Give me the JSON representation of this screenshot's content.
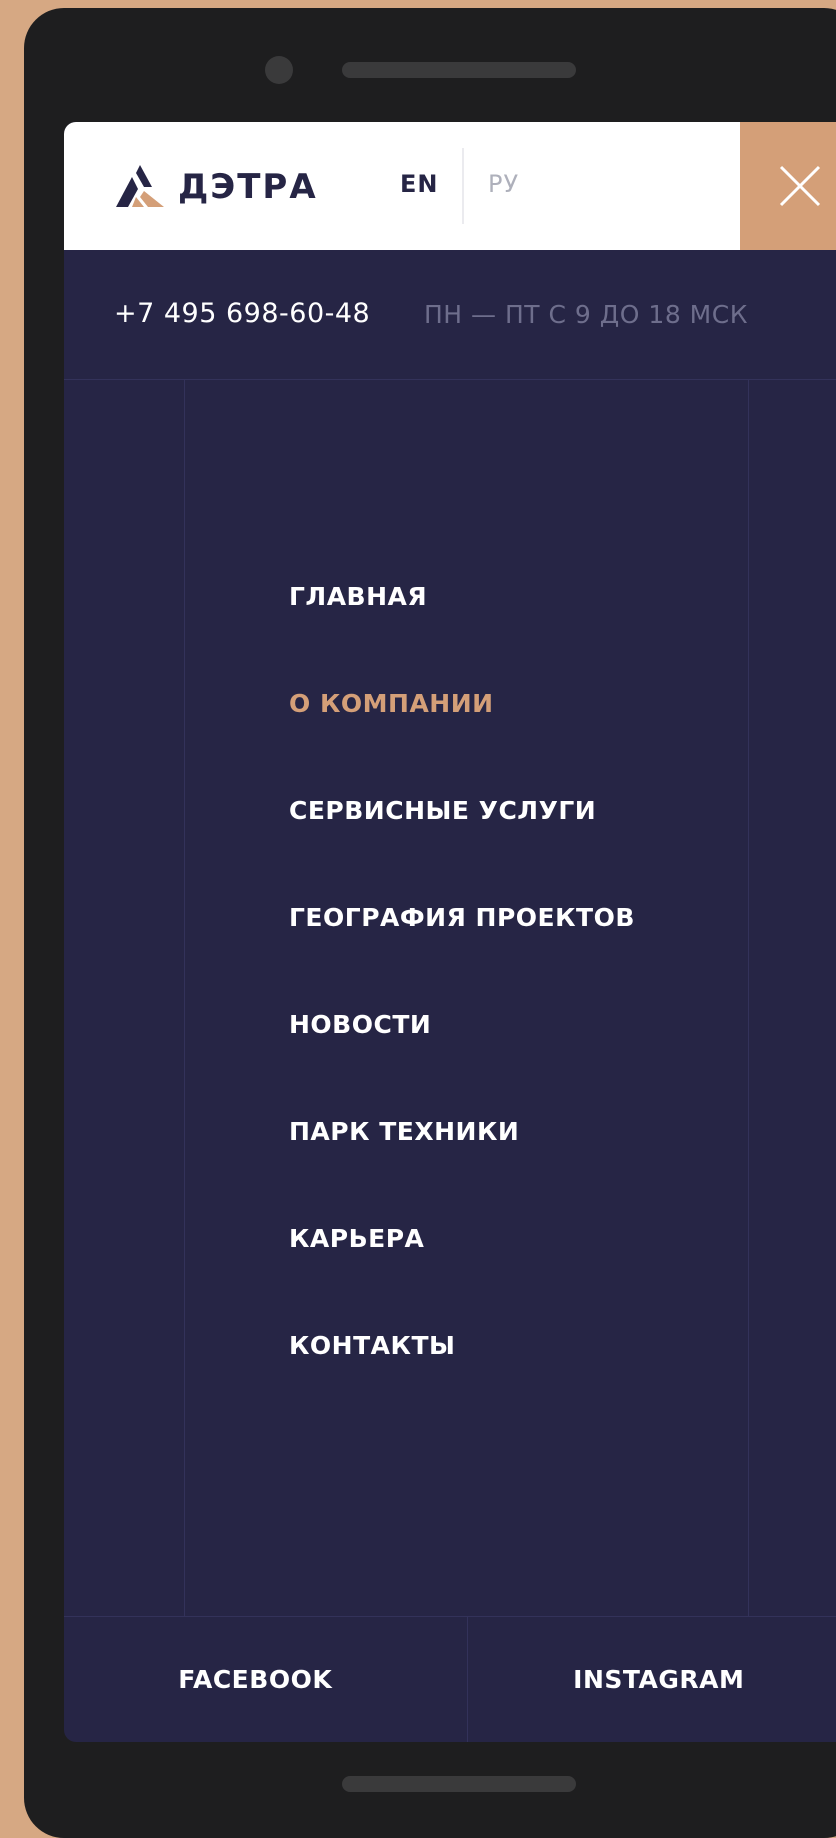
{
  "header": {
    "brand": "ДЭТРА",
    "lang_en": "EN",
    "lang_ru": "РУ"
  },
  "contact": {
    "phone": "+7 495 698-60-48",
    "hours": "ПН — ПТ С 9 ДО 18 МСК"
  },
  "menu": {
    "items": [
      {
        "label": "ГЛАВНАЯ",
        "active": false
      },
      {
        "label": "О КОМПАНИИ",
        "active": true
      },
      {
        "label": "СЕРВИСНЫЕ УСЛУГИ",
        "active": false
      },
      {
        "label": "ГЕОГРАФИЯ ПРОЕКТОВ",
        "active": false
      },
      {
        "label": "НОВОСТИ",
        "active": false
      },
      {
        "label": "ПАРК ТЕХНИКИ",
        "active": false
      },
      {
        "label": "КАРЬЕРА",
        "active": false
      },
      {
        "label": "КОНТАКТЫ",
        "active": false
      }
    ]
  },
  "footer": {
    "facebook": "FACEBOOK",
    "instagram": "INSTAGRAM"
  },
  "colors": {
    "background": "#d6a883",
    "menu_bg": "#262545",
    "accent": "#d49f78",
    "text_light": "#ffffff",
    "text_muted": "#6e6e8c"
  },
  "icons": {
    "logo": "detra-logo-icon",
    "close": "close-icon"
  }
}
